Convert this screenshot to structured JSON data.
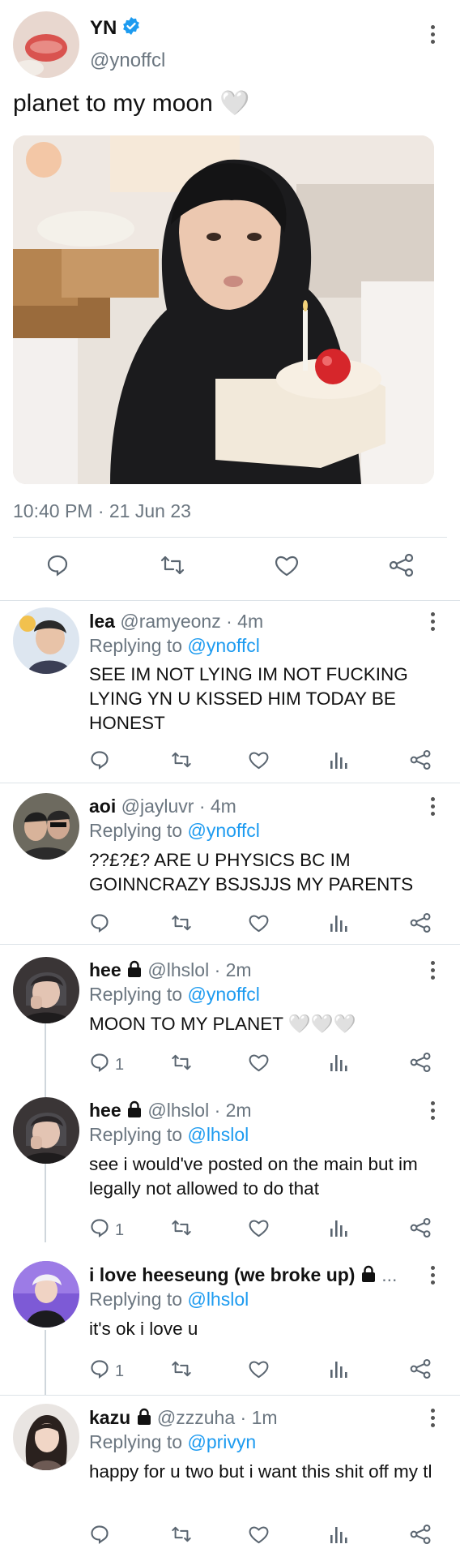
{
  "post": {
    "display_name": "YN",
    "handle": "@ynoffcl",
    "text": "planet to my moon 🤍",
    "timestamp": "10:40 PM · 21 Jun 23",
    "icons": [
      "reply-icon",
      "retweet-icon",
      "like-icon",
      "share-icon"
    ]
  },
  "replies": [
    {
      "name": "lea",
      "handle": "@ramyeonz · 4m",
      "replying_label": "Replying to ",
      "replying_to": "@ynoffcl",
      "text": "SEE IM NOT LYING IM NOT FUCKING LYING YN U KISSED HIM TODAY BE HONEST",
      "reply_count": ""
    },
    {
      "name": "aoi",
      "handle": "@jayluvr · 4m",
      "replying_label": "Replying to ",
      "replying_to": "@ynoffcl",
      "text": "??£?£? ARE U PHYSICS BC IM GOINNCRAZY BSJSJJS MY PARENTS",
      "reply_count": ""
    },
    {
      "name": "hee",
      "handle": "@lhslol · 2m",
      "replying_label": "Replying to ",
      "replying_to": "@ynoffcl",
      "text": "MOON TO MY PLANET 🤍🤍🤍",
      "reply_count": "1"
    },
    {
      "name": "hee",
      "handle": "@lhslol · 2m",
      "replying_label": "Replying to ",
      "replying_to": "@lhslol",
      "text": "see i would've posted on the main but im legally not allowed to do that",
      "reply_count": "1"
    },
    {
      "name": "i love heeseung (we broke up)",
      "handle": "...",
      "replying_label": "Replying to ",
      "replying_to": "@lhslol",
      "text": "it's ok i love u",
      "reply_count": "1"
    },
    {
      "name": "kazu",
      "handle": "@zzzuha · 1m",
      "replying_label": "Replying to ",
      "replying_to": "@privyn",
      "text": "happy for u two but i want this shit off my tl",
      "reply_count": ""
    }
  ],
  "colors": {
    "link": "#1d9bf0",
    "verified": "#1d9bf0",
    "muted": "#6b7680",
    "separator": "#dde3e8"
  }
}
